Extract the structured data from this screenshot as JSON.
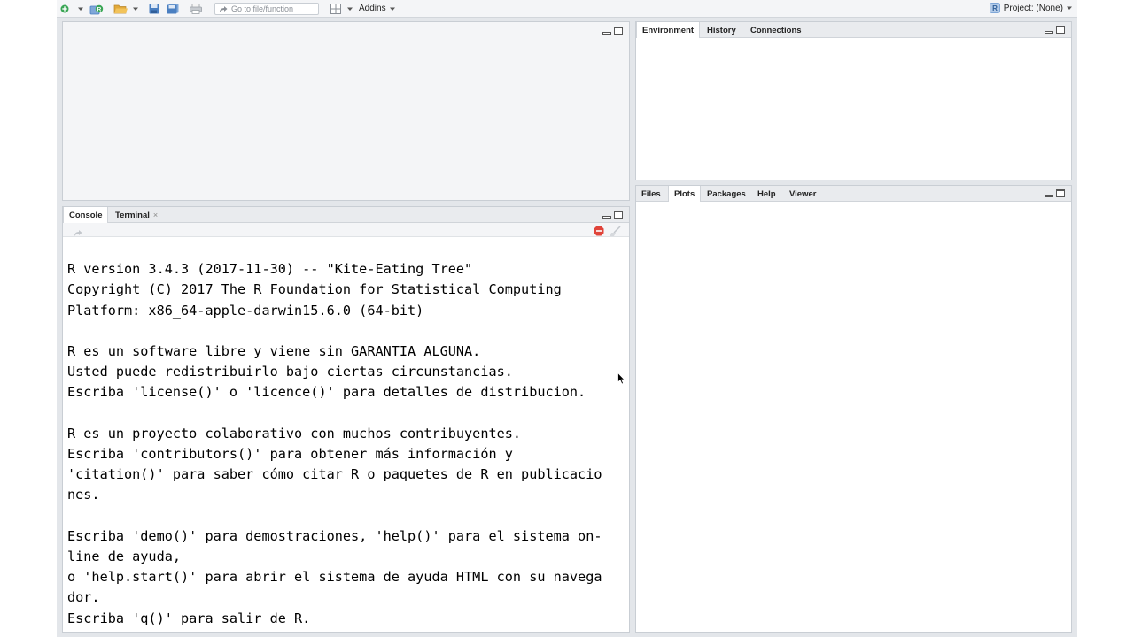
{
  "toolbar": {
    "go_to_file_placeholder": "Go to file/function",
    "addins_label": "Addins",
    "project_label": "Project: (None)",
    "project_icon_letter": "R"
  },
  "panes": {
    "environment": {
      "tabs": [
        "Environment",
        "History",
        "Connections"
      ],
      "active": "Environment"
    },
    "files": {
      "tabs": [
        "Files",
        "Plots",
        "Packages",
        "Help",
        "Viewer"
      ],
      "active": "Plots"
    },
    "console": {
      "tabs": [
        "Console",
        "Terminal"
      ],
      "active": "Console",
      "terminal_close": "×",
      "lines": [
        "",
        "R version 3.4.3 (2017-11-30) -- \"Kite-Eating Tree\"",
        "Copyright (C) 2017 The R Foundation for Statistical Computing",
        "Platform: x86_64-apple-darwin15.6.0 (64-bit)",
        "",
        "R es un software libre y viene sin GARANTIA ALGUNA.",
        "Usted puede redistribuirlo bajo ciertas circunstancias.",
        "Escriba 'license()' o 'licence()' para detalles de distribucion.",
        "",
        "R es un proyecto colaborativo con muchos contribuyentes.",
        "Escriba 'contributors()' para obtener más información y",
        "'citation()' para saber cómo citar R o paquetes de R en publicacio",
        "nes.",
        "",
        "Escriba 'demo()' para demostraciones, 'help()' para el sistema on-",
        "line de ayuda,",
        "o 'help.start()' para abrir el sistema de ayuda HTML con su navega",
        "dor.",
        "Escriba 'q()' para salir de R."
      ]
    }
  },
  "colors": {
    "stop_icon": "#e0443a",
    "add_icon": "#3aa655",
    "folder_icon": "#e2a93a",
    "save_icon": "#4a7fc1"
  }
}
